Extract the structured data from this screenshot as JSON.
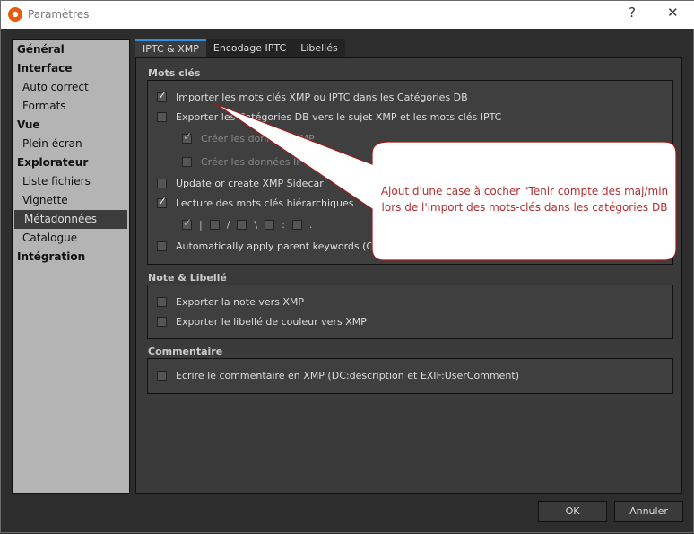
{
  "window": {
    "title": "Paramètres",
    "help": "?",
    "close": "✕"
  },
  "sidebar": {
    "items": [
      {
        "label": "Général",
        "type": "cat"
      },
      {
        "label": "Interface",
        "type": "cat"
      },
      {
        "label": "Auto correct",
        "type": "sub"
      },
      {
        "label": "Formats",
        "type": "sub"
      },
      {
        "label": "Vue",
        "type": "cat"
      },
      {
        "label": "Plein écran",
        "type": "sub"
      },
      {
        "label": "Explorateur",
        "type": "cat"
      },
      {
        "label": "Liste fichiers",
        "type": "sub"
      },
      {
        "label": "Vignette",
        "type": "sub"
      },
      {
        "label": "Métadonnées",
        "type": "sub",
        "selected": true
      },
      {
        "label": "Catalogue",
        "type": "sub"
      },
      {
        "label": "Intégration",
        "type": "cat"
      }
    ]
  },
  "tabs": [
    "IPTC & XMP",
    "Encodage IPTC",
    "Libellés"
  ],
  "groups": {
    "mots_cles": {
      "label": "Mots clés",
      "items": [
        "Importer les mots clés XMP ou IPTC dans les Catégories DB",
        "Exporter les Catégories DB vers le sujet XMP et les mots clés IPTC",
        "Créer les données XMP",
        "Créer les données IPTC",
        "Update or create XMP Sidecar",
        "Lecture des mots clés hiérarchiques",
        "Automatically apply parent keywords (Ctrl+click to ignore)"
      ],
      "separators": [
        "|",
        "/",
        "\\",
        ":",
        "."
      ]
    },
    "note": {
      "label": "Note & Libellé",
      "items": [
        "Exporter la note vers XMP",
        "Exporter le libellé de couleur vers XMP"
      ]
    },
    "commentaire": {
      "label": "Commentaire",
      "items": [
        "Ecrire le commentaire en XMP (DC:description et EXIF:UserComment)"
      ]
    }
  },
  "buttons": {
    "ok": "OK",
    "cancel": "Annuler"
  },
  "callout": {
    "line1": "Ajout d'une case à cocher \"Tenir compte des maj/min",
    "line2": "lors de l'import des mots-clés dans les catégories DB"
  }
}
